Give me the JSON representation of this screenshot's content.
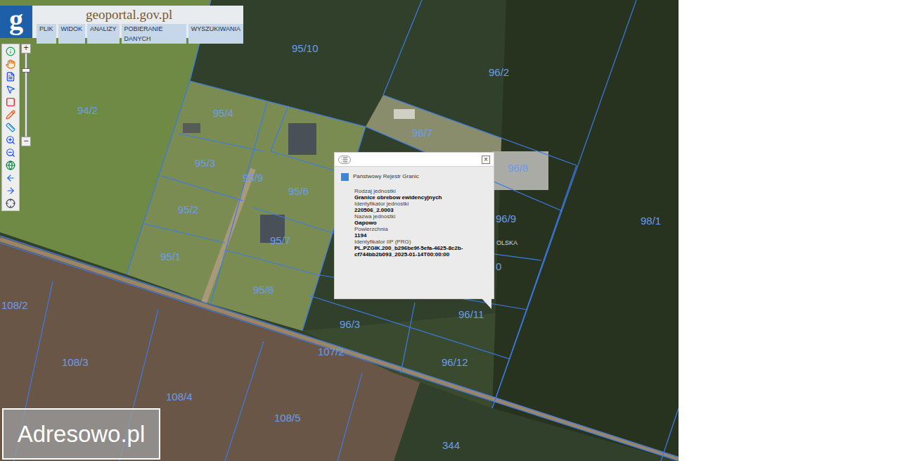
{
  "app": {
    "logo": "g",
    "title": "geoportal.gov.pl"
  },
  "menu": [
    {
      "label": "PLIK"
    },
    {
      "label": "WIDOK"
    },
    {
      "label": "ANALIZY"
    },
    {
      "label": "POBIERANIE DANYCH"
    },
    {
      "label": "WYSZUKIWANIA"
    }
  ],
  "zoom": {
    "plus": "+",
    "minus": "−",
    "level": 0.82
  },
  "parcels": [
    "95/10",
    "96/2",
    "94/2",
    "95/4",
    "96/7",
    "95/3",
    "96/8",
    "95/9",
    "95/6",
    "95/2",
    "96/9",
    "98/1",
    "95/1",
    "95/7",
    "0",
    "95/8",
    "108/2",
    "96/11",
    "96/3",
    "107/2",
    "108/3",
    "96/12",
    "108/4",
    "108/5",
    "344"
  ],
  "street": "OLSKA",
  "popup": {
    "title": "Państwowy Rejestr Granic",
    "close": "×",
    "fields": [
      {
        "label": "Rodzaj jednostki",
        "value": "Granice obrebow ewidencyjnych"
      },
      {
        "label": "Identyfikator jednostki",
        "value": "220506_2.0003"
      },
      {
        "label": "Nazwa jednostki",
        "value": "Gapowo"
      },
      {
        "label": "Powierzchnia",
        "value": "1194"
      },
      {
        "label": "Identyfikator IIP (PRG)",
        "value": "PL.PZGIK.200_b296be9f-5efa-4625-8c2b-cf744bb2b093_2025-01-14T00:00:00"
      }
    ]
  },
  "watermark": "Adresowo.pl"
}
